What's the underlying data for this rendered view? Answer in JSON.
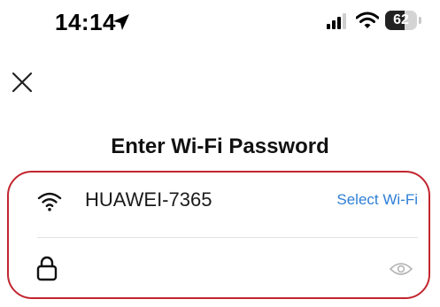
{
  "status_bar": {
    "time": "14:14",
    "battery_level": "62",
    "battery_fraction": 0.62,
    "icons": [
      "location-arrow-icon",
      "cellular-signal-icon",
      "wifi-icon",
      "battery-icon"
    ]
  },
  "header": {
    "close_icon": "close-icon",
    "title": "Enter Wi-Fi Password"
  },
  "form": {
    "network_name": "HUAWEI-7365",
    "select_wifi_label": "Select Wi-Fi",
    "password_value": "",
    "password_placeholder": ""
  },
  "colors": {
    "link": "#2f7fd6",
    "highlight_outline": "#c2262f",
    "icon_gray": "#b5b5b5"
  }
}
